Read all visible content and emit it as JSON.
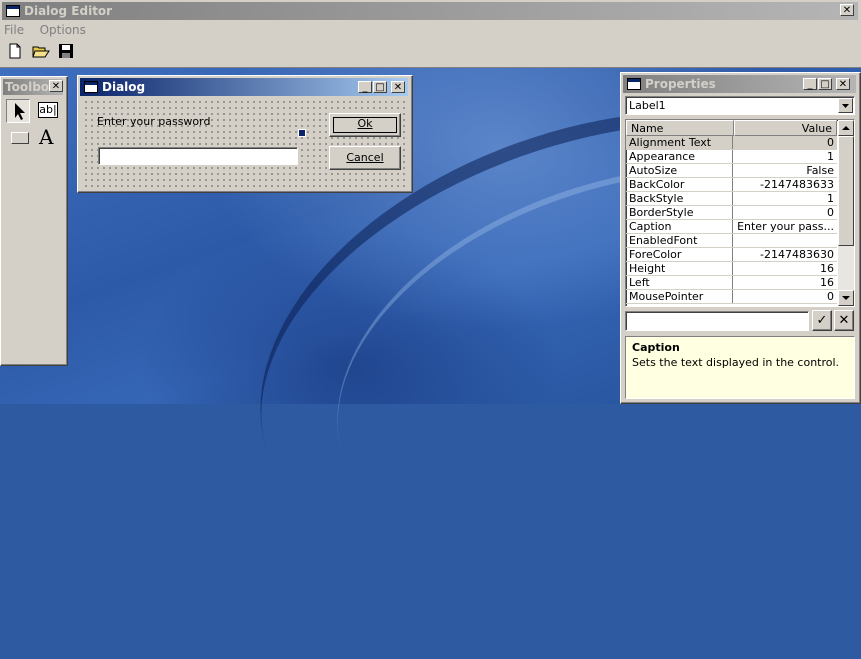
{
  "editor": {
    "title": "Dialog Editor",
    "close_glyph": "✕",
    "menu": [
      {
        "label": "File"
      },
      {
        "label": "Options"
      }
    ],
    "toolbar": [
      {
        "icon": "new-file-icon"
      },
      {
        "icon": "open-folder-icon"
      },
      {
        "icon": "save-disk-icon"
      }
    ]
  },
  "toolbox": {
    "title": "Toolbo",
    "close_glyph": "✕",
    "tools": {
      "pointer": "pointer-icon",
      "textbox": "ab|",
      "button": "button-icon",
      "label": "A"
    }
  },
  "dialog": {
    "title": "Dialog",
    "min_glyph": "_",
    "max_glyph": "□",
    "close_glyph": "✕",
    "label_text": "Enter your password",
    "input_value": "",
    "ok_label": "Ok",
    "cancel_label": "Cancel"
  },
  "properties": {
    "title": "Properties",
    "object_select": "Label1",
    "columns": {
      "name": "Name",
      "value": "Value"
    },
    "rows": [
      {
        "name": "Alignment Text",
        "value": "0"
      },
      {
        "name": "Appearance",
        "value": "1"
      },
      {
        "name": "AutoSize",
        "value": "False"
      },
      {
        "name": "BackColor",
        "value": "-2147483633"
      },
      {
        "name": "BackStyle",
        "value": "1"
      },
      {
        "name": "BorderStyle",
        "value": "0"
      },
      {
        "name": "Caption",
        "value": "Enter your pass..."
      },
      {
        "name": "EnabledFont",
        "value": ""
      },
      {
        "name": "ForeColor",
        "value": "-2147483630"
      },
      {
        "name": "Height",
        "value": "16"
      },
      {
        "name": "Left",
        "value": "16"
      },
      {
        "name": "MousePointer",
        "value": "0"
      }
    ],
    "edit_value": "",
    "accept_glyph": "✓",
    "cancel_glyph": "✕",
    "help_title": "Caption",
    "help_text": "Sets the text displayed in the control."
  },
  "colors": {
    "active_title": "#0a246a",
    "inactive_title": "#808080",
    "face": "#d4d0c8",
    "help_bg": "#ffffe1"
  }
}
